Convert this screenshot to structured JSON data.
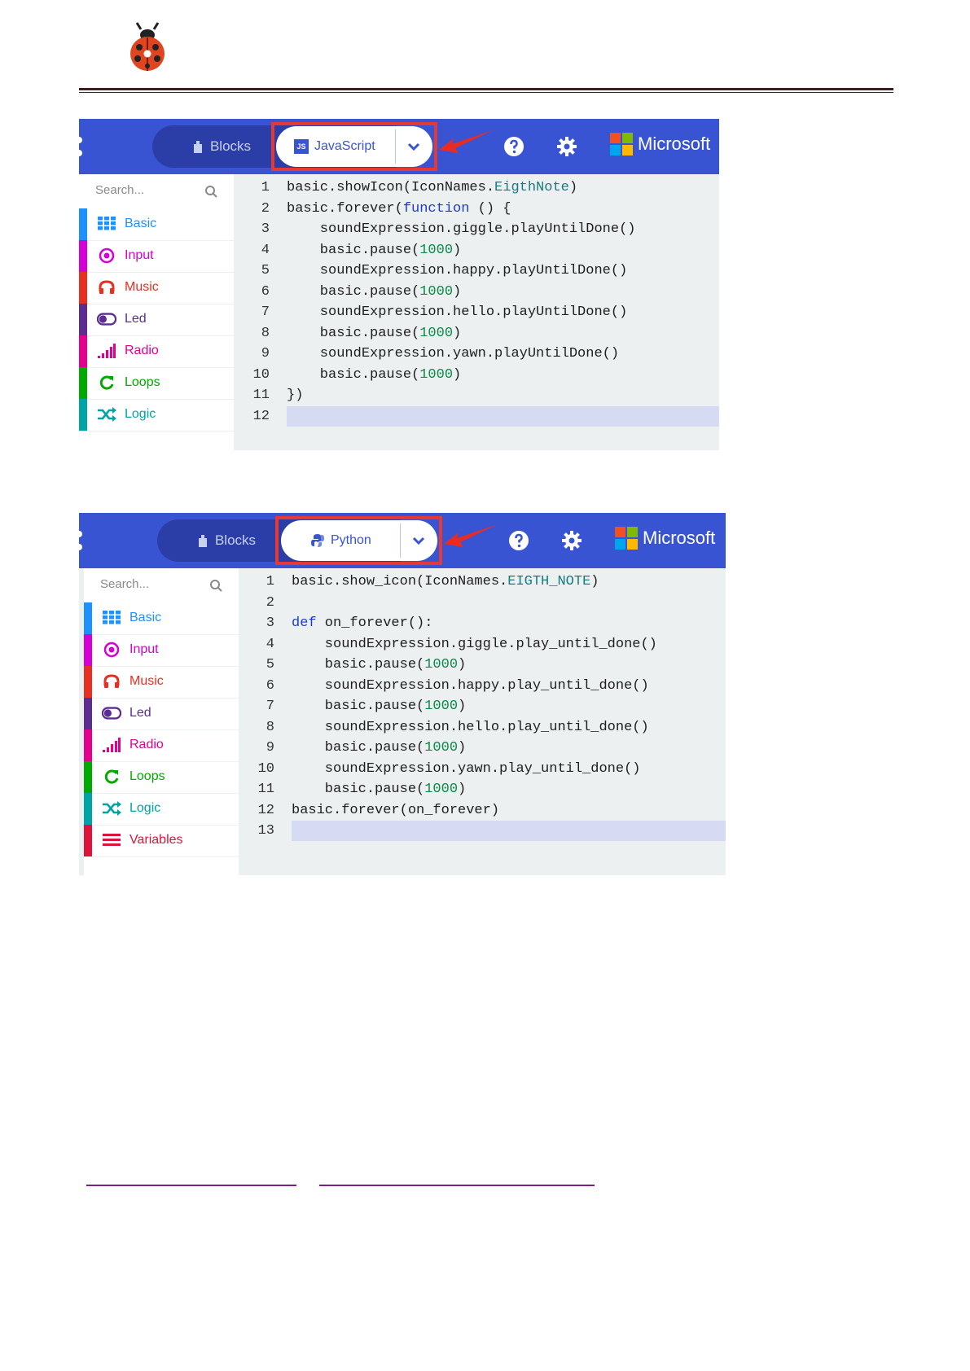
{
  "screenshot_js": {
    "toolbar": {
      "blocks_label": "Blocks",
      "language_label": "JavaScript",
      "language_badge": "JS",
      "brand": "Microsoft"
    },
    "sidebar": {
      "search_placeholder": "Search...",
      "categories": [
        {
          "label": "Basic",
          "color": "#1e90ff"
        },
        {
          "label": "Input",
          "color": "#d400d4"
        },
        {
          "label": "Music",
          "color": "#e63022"
        },
        {
          "label": "Led",
          "color": "#5c2d91"
        },
        {
          "label": "Radio",
          "color": "#e3008c"
        },
        {
          "label": "Loops",
          "color": "#00aa00"
        },
        {
          "label": "Logic",
          "color": "#00a4a6"
        }
      ]
    },
    "code": [
      {
        "n": "1",
        "text": "basic.showIcon(IconNames.EigthNote)"
      },
      {
        "n": "2",
        "text": "basic.forever(function () {"
      },
      {
        "n": "3",
        "text": "    soundExpression.giggle.playUntilDone()"
      },
      {
        "n": "4",
        "text": "    basic.pause(1000)"
      },
      {
        "n": "5",
        "text": "    soundExpression.happy.playUntilDone()"
      },
      {
        "n": "6",
        "text": "    basic.pause(1000)"
      },
      {
        "n": "7",
        "text": "    soundExpression.hello.playUntilDone()"
      },
      {
        "n": "8",
        "text": "    basic.pause(1000)"
      },
      {
        "n": "9",
        "text": "    soundExpression.yawn.playUntilDone()"
      },
      {
        "n": "10",
        "text": "    basic.pause(1000)"
      },
      {
        "n": "11",
        "text": "})"
      },
      {
        "n": "12",
        "text": ""
      }
    ]
  },
  "screenshot_py": {
    "toolbar": {
      "blocks_label": "Blocks",
      "language_label": "Python",
      "brand": "Microsoft"
    },
    "sidebar": {
      "search_placeholder": "Search...",
      "categories": [
        {
          "label": "Basic",
          "color": "#1e90ff"
        },
        {
          "label": "Input",
          "color": "#d400d4"
        },
        {
          "label": "Music",
          "color": "#e63022"
        },
        {
          "label": "Led",
          "color": "#5c2d91"
        },
        {
          "label": "Radio",
          "color": "#e3008c"
        },
        {
          "label": "Loops",
          "color": "#00aa00"
        },
        {
          "label": "Logic",
          "color": "#00a4a6"
        },
        {
          "label": "Variables",
          "color": "#dc143c"
        }
      ]
    },
    "code": [
      {
        "n": "1",
        "text": "basic.show_icon(IconNames.EIGTH_NOTE)"
      },
      {
        "n": "2",
        "text": ""
      },
      {
        "n": "3",
        "text": "def on_forever():"
      },
      {
        "n": "4",
        "text": "    soundExpression.giggle.play_until_done()"
      },
      {
        "n": "5",
        "text": "    basic.pause(1000)"
      },
      {
        "n": "6",
        "text": "    soundExpression.happy.play_until_done()"
      },
      {
        "n": "7",
        "text": "    basic.pause(1000)"
      },
      {
        "n": "8",
        "text": "    soundExpression.hello.play_until_done()"
      },
      {
        "n": "9",
        "text": "    basic.pause(1000)"
      },
      {
        "n": "10",
        "text": "    soundExpression.yawn.play_until_done()"
      },
      {
        "n": "11",
        "text": "    basic.pause(1000)"
      },
      {
        "n": "12",
        "text": "basic.forever(on_forever)"
      },
      {
        "n": "13",
        "text": ""
      }
    ]
  },
  "colors": {
    "toolbar_blue": "#3954d2",
    "highlight_red": "#e53935",
    "link_purple": "#7a1f86"
  }
}
